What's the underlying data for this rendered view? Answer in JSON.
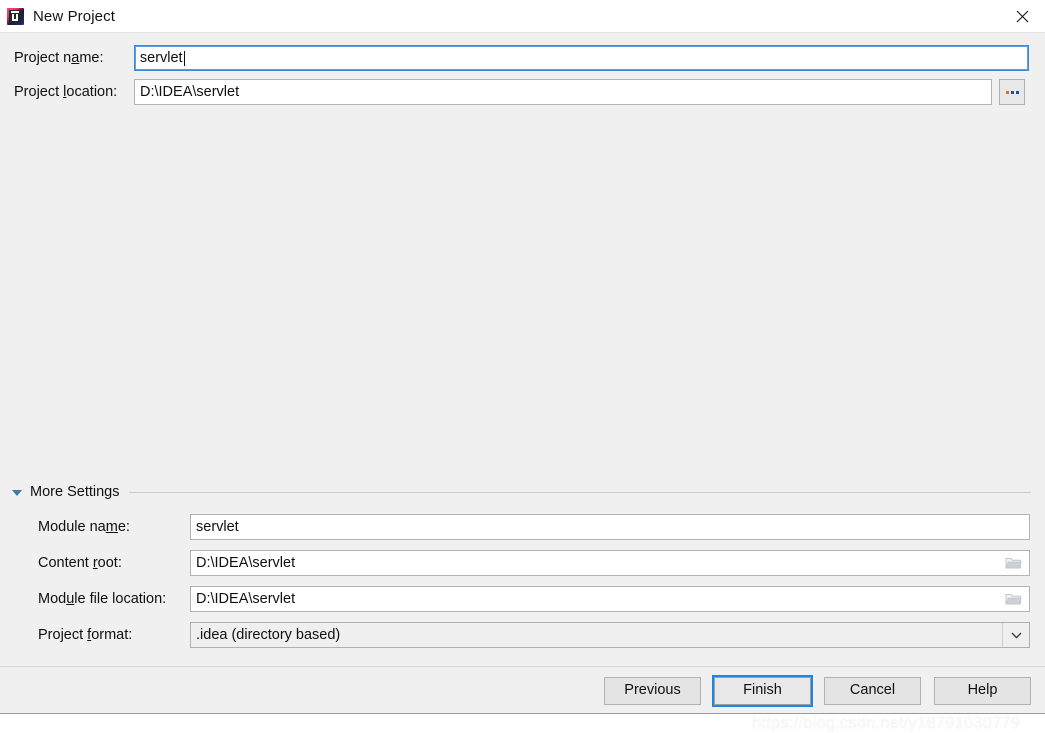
{
  "window": {
    "title": "New Project",
    "app_icon": "intellij-idea-icon",
    "close_icon": "close-icon"
  },
  "top_form": {
    "project_name": {
      "label_before": "Project n",
      "label_mnemonic": "a",
      "label_after": "me:",
      "label_full": "Project name:",
      "value": "servlet",
      "focused": true
    },
    "project_location": {
      "label_before": "Project ",
      "label_mnemonic": "l",
      "label_after": "ocation:",
      "label_full": "Project location:",
      "value": "D:\\IDEA\\servlet",
      "browse_button": "..."
    }
  },
  "more_settings": {
    "label_before": "Mor",
    "label_mnemonic": "e",
    "label_after": " Settings",
    "label_full": "More Settings",
    "expanded": true,
    "toggle_icon": "triangle-down-icon",
    "fields": {
      "module_name": {
        "label_before": "Module na",
        "label_mnemonic": "m",
        "label_after": "e:",
        "label_full": "Module name:",
        "value": "servlet"
      },
      "content_root": {
        "label_before": "Content ",
        "label_mnemonic": "r",
        "label_after": "oot:",
        "label_full": "Content root:",
        "value": "D:\\IDEA\\servlet",
        "browse_icon": "folder-icon"
      },
      "module_file_location": {
        "label_before": "Mod",
        "label_mnemonic": "u",
        "label_after": "le file location:",
        "label_full": "Module file location:",
        "value": "D:\\IDEA\\servlet",
        "browse_icon": "folder-icon"
      },
      "project_format": {
        "label_before": "Project ",
        "label_mnemonic": "f",
        "label_after": "ormat:",
        "label_full": "Project format:",
        "value": ".idea (directory based)",
        "arrow_icon": "chevron-down-icon",
        "options": [
          ".idea (directory based)"
        ]
      }
    }
  },
  "footer": {
    "previous_label": "Previous",
    "finish_label": "Finish",
    "cancel_label": "Cancel",
    "help_label": "Help",
    "default_button": "Finish"
  },
  "watermark": {
    "text": "https://blog.csdn.net/y18791030779"
  },
  "colors": {
    "dialog_bg": "#f0f0f0",
    "titlebar_bg": "#ffffff",
    "field_bg": "#ffffff",
    "field_border": "#b4b4b4",
    "focus_blue": "#3d8ad6",
    "default_button_ring": "#1d87e4",
    "triangle_teal": "#3f7d9e",
    "combo_bg": "#efefef"
  }
}
